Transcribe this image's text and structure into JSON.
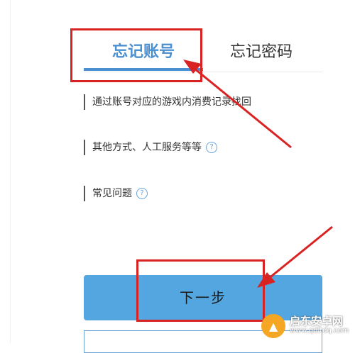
{
  "tabs": {
    "account": "忘记账号",
    "password": "忘记密码"
  },
  "options": [
    {
      "label": "通过账号对应的游戏内消费记录找回"
    },
    {
      "label": "其他方式、人工服务等等",
      "help": "?"
    },
    {
      "label": "常见问题",
      "help": "?"
    }
  ],
  "next_button": "下一步",
  "watermark": {
    "title": "启东安卓网",
    "url": "www.qdltdq.com"
  },
  "colors": {
    "accent": "#4a8fd0",
    "button": "#54a6e0",
    "annotation": "#d92323"
  }
}
